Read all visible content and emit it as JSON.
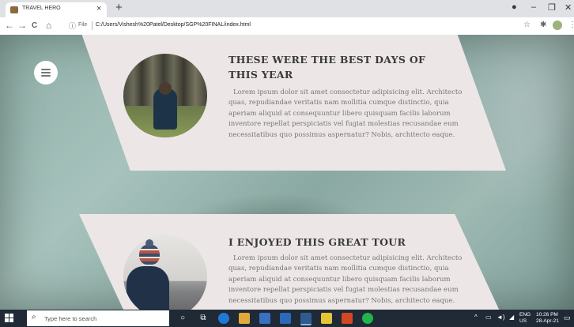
{
  "browser": {
    "tab_title": "TRAVEL HERO",
    "tab_close": "×",
    "new_tab": "+",
    "window_controls": {
      "minimize": "–",
      "restore": "❐",
      "close": "✕"
    },
    "nav": {
      "back": "←",
      "forward": "→",
      "reload": "C",
      "home": "⌂"
    },
    "address": {
      "scheme_label": "File",
      "url": "C:/Users/Vishesh%20Patel/Desktop/SGP%20FINAL/index.html"
    },
    "icons": [
      "info-icon",
      "star-icon",
      "extensions-icon",
      "profile-avatar",
      "kebab-menu-icon"
    ]
  },
  "page": {
    "cards": [
      {
        "title": "THESE WERE THE BEST DAYS OF THIS YEAR",
        "text": "Lorem ipsum dolor sit amet consectetur adipisicing elit. Architecto quas, repudiandae veritatis nam mollitia cumque distinctio, quia aperiam aliquid at consequuntur libero quisquam facilis laborum inventore repellat perspiciatis vel fugiat molestias recusandae eum necessitatibus quo possimus aspernatur? Nobis, architecto eaque."
      },
      {
        "title": "I ENJOYED THIS GREAT TOUR",
        "text": "Lorem ipsum dolor sit amet consectetur adipisicing elit. Architecto quas, repudiandae veritatis nam mollitia cumque distinctio, quia aperiam aliquid at consequuntur libero quisquam facilis laborum inventore repellat perspiciatis vel fugiat molestias recusandae eum necessitatibus quo possimus aspernatur? Nobis, architecto eaque."
      }
    ]
  },
  "taskbar": {
    "search_placeholder": "Type here to search",
    "tray": {
      "lang_top": "ENG",
      "lang_bottom": "US",
      "time": "10:26 PM",
      "date": "28-Apr-21",
      "chevron": "^"
    }
  },
  "colors": {
    "card_bg": "#ece7e6",
    "title": "#3a3a3a",
    "body_text": "#777777",
    "taskbar": "#1f2a36"
  }
}
